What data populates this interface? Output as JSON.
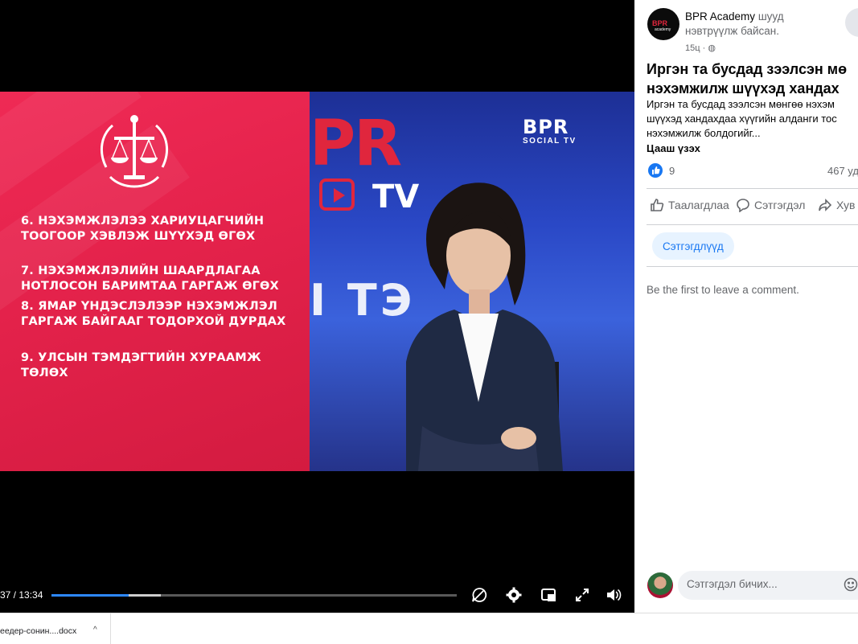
{
  "video": {
    "points": [
      "6. НЭХЭМЖЛЭЛЭЭ ХАРИУЦАГЧИЙН\nТООГООР ХЭВЛЭЖ ШҮҮХЭД ӨГӨХ",
      "7. НЭХЭМЖЛЭЛИЙН ШААРДЛАГАА\nНОТЛОСОН БАРИМТАА ГАРГАЖ ӨГӨХ",
      "8. ЯМАР ҮНДЭСЛЭЛЭЭР НЭХЭМЖЛЭЛ\nГАРГАЖ БАЙГААГ ТОДОРХОЙ ДУРДАХ",
      "9. УЛСЫН ТЭМДЭГТИЙН ХУРААМЖ\nТӨЛӨХ"
    ],
    "bg_logo_text": "PR",
    "tv_text": "TV",
    "bg_word": "І ТЭ",
    "corner_logo": {
      "main": "BPR",
      "sub": "SOCIAL TV"
    },
    "time": "37 / 13:34",
    "progress": 0.19,
    "buffered": 0.27,
    "accent": "#2d88ff"
  },
  "download": {
    "filename": "еедер-сонин....docx"
  },
  "post": {
    "page_name": "BPR Academy",
    "status": "шууд нэвтрүүлж байсан.",
    "time": "15ц",
    "avatar_text": "BPR",
    "avatar_sub": "academy",
    "title": "Иргэн та бусдад зээлсэн мө\nнэхэмжилж шүүхэд хандах",
    "text": "Иргэн та бусдад зээлсэн мөнгөө нэхэм\nшүүхэд хандахдаа хүүгийн алданги тос\nнэхэмжилж болдогийг...",
    "see_more": "Цааш үзэх",
    "likes": "9",
    "views": "467 уд",
    "actions": {
      "like": "Таалагдлаа",
      "comment": "Сэтгэгдэл",
      "share": "Хув"
    },
    "comments_tab": "Сэтгэгдлүүд",
    "empty_comments": "Be the first to leave a comment.",
    "comment_placeholder": "Сэтгэгдэл бичих..."
  }
}
